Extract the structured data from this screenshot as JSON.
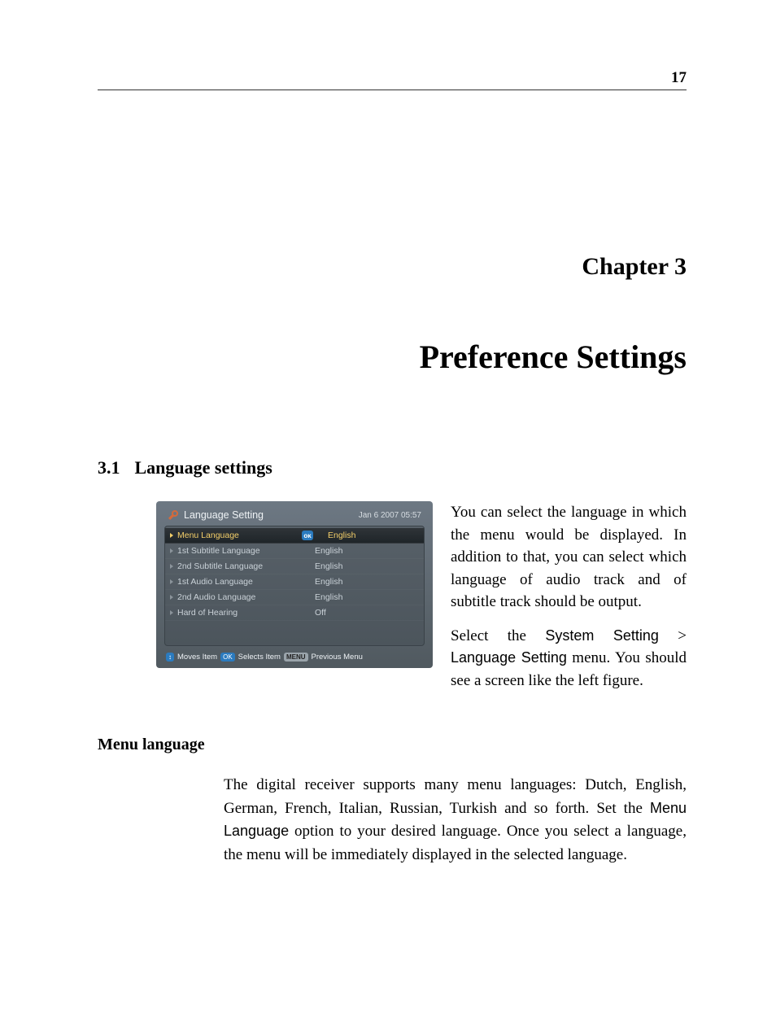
{
  "page": {
    "number": "17",
    "chapter_label": "Chapter 3",
    "chapter_title": "Preference Settings",
    "section_number": "3.1",
    "section_title": "Language settings",
    "subheading": "Menu language"
  },
  "intro": {
    "p1": "You can select the language in which the menu would be displayed. In addition to that, you can select which language of audio track and of subtitle track should be output.",
    "p2_a": "Select the ",
    "p2_nav1": "System Setting",
    "p2_gt": " > ",
    "p2_nav2": "Language Setting",
    "p2_b": " menu. You should see a screen like the left figure."
  },
  "body": {
    "p1_a": "The digital receiver supports many menu languages: Dutch, English, German, French, Italian, Russian, Turkish and so forth. Set the ",
    "p1_opt": "Menu Language",
    "p1_b": " option to your desired language. Once you select a language, the menu will be immediately displayed in the selected language."
  },
  "figure": {
    "title": "Language Setting",
    "timestamp": "Jan 6 2007 05:57",
    "rows": [
      {
        "label": "Menu Language",
        "value": "English",
        "selected": true
      },
      {
        "label": "1st Subtitle Language",
        "value": "English",
        "selected": false
      },
      {
        "label": "2nd Subtitle Language",
        "value": "English",
        "selected": false
      },
      {
        "label": "1st Audio Language",
        "value": "English",
        "selected": false
      },
      {
        "label": "2nd Audio Language",
        "value": "English",
        "selected": false
      },
      {
        "label": "Hard of Hearing",
        "value": "Off",
        "selected": false
      }
    ],
    "footer": {
      "nav_key": "↕",
      "moves": "Moves Item",
      "ok_key": "OK",
      "selects": "Selects Item",
      "menu_key": "MENU",
      "prev": "Previous Menu"
    }
  }
}
